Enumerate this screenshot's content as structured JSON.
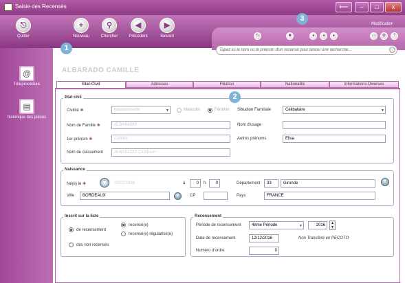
{
  "window": {
    "title": "Saisie des Recensés",
    "min": "–",
    "max": "□",
    "close": "x",
    "back": "⟵"
  },
  "toolbar": {
    "quit": "Quitter",
    "new": "Nouveau",
    "search": "Chercher",
    "prev": "Précédent",
    "next": "Suivant"
  },
  "panel": {
    "mode": "Modification",
    "search_placeholder": "Tapez ici le nom ou le prénom d'un recensé pour lancer une recherche..."
  },
  "sidebar": {
    "items": [
      {
        "label": "Téléprocédure"
      },
      {
        "label": "historique des pièces"
      }
    ]
  },
  "person": {
    "name": "ALBARADO CAMILLE"
  },
  "tabs": [
    "Etat-Civil",
    "Adresses",
    "Filiation",
    "Nationalité",
    "Informations Diverses"
  ],
  "etat_civil": {
    "legend": "Etat civil",
    "civilite_label": "Civilité",
    "civilite_value": "Mademoiselle",
    "masculin": "Masculin",
    "feminin": "Féminin",
    "sit_fam_label": "Situation Familiale",
    "sit_fam_value": "Célibataire",
    "nom_famille_label": "Nom de Famille",
    "nom_famille_value": "ALBARADO",
    "nom_usage_label": "Nom d'usage",
    "nom_usage_value": "",
    "prenom_label": "1er prénom",
    "prenom_value": "Camille",
    "autres_prenoms_label": "Autres prénoms",
    "autres_prenoms_value": "Elisa",
    "classement_label": "Nom de classement",
    "classement_value": "ALBARADO CAMILLE"
  },
  "naissance": {
    "legend": "Naissance",
    "ne_le_label": "Né(e) le",
    "date_value": "01/01/1999",
    "a_label": "à",
    "h_value": "0",
    "h_label": "h",
    "m_value": "0",
    "dep_label": "Département",
    "dep_code": "33",
    "dep_name": "Gironde",
    "ville_label": "Ville",
    "ville_value": "BORDEAUX",
    "cp_label": "CP",
    "cp_value": "",
    "pays_label": "Pays",
    "pays_value": "FRANCE"
  },
  "inscrit": {
    "legend": "Inscrit sur la liste",
    "de_recensement": "de recensement",
    "recense": "recensé(e)",
    "regularise": "recensé(e) régularisé(e)",
    "non_recenses": "des non recensés"
  },
  "recensement": {
    "legend": "Recensement",
    "periode_label": "Période de recensement",
    "periode_value": "4ème Période",
    "annee_value": "2016",
    "date_label": "Date de recensement",
    "date_value": "12/12/2016",
    "status": "Non Transféré en PECOTO",
    "ordre_label": "Numéro d'ordre",
    "ordre_value": "0"
  },
  "callouts": [
    "1",
    "2",
    "3"
  ]
}
